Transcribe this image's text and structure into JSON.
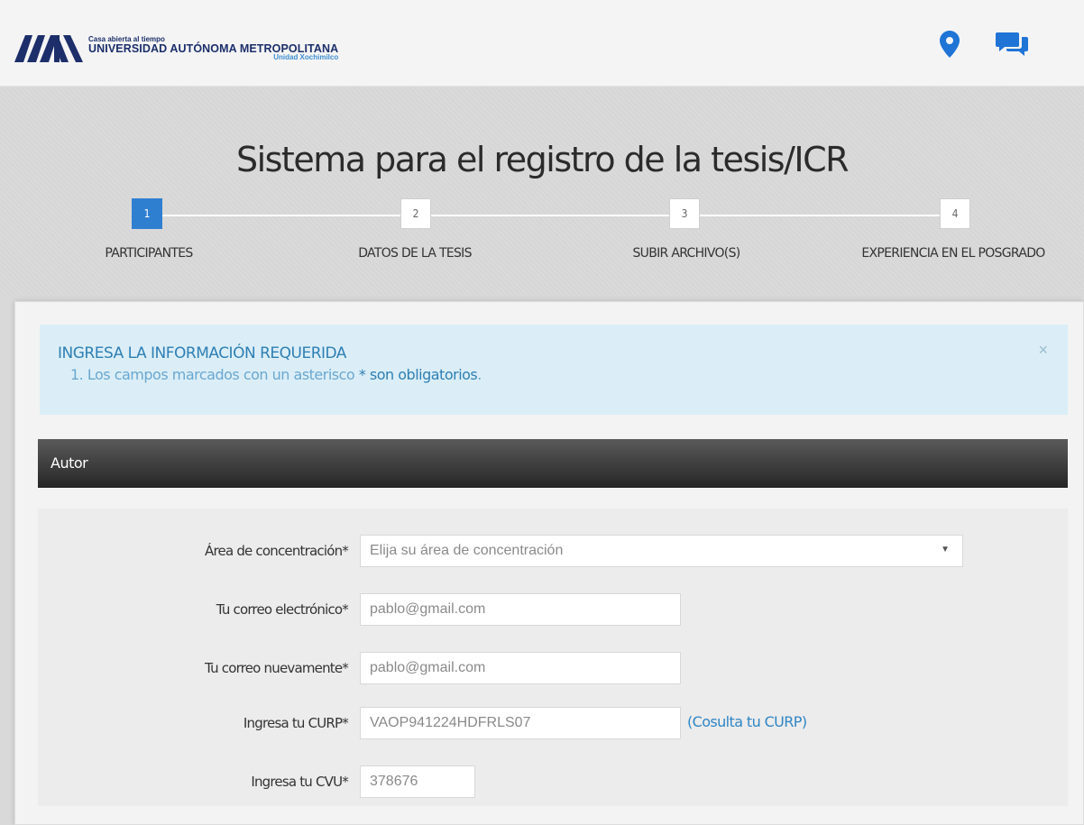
{
  "header": {
    "logo_small": "Casa abierta al tiempo",
    "logo_main": "UNIVERSIDAD AUTÓNOMA METROPOLITANA",
    "logo_sub": "Unidad Xochimilco",
    "icons": [
      "location-pin-icon",
      "chat-icon"
    ],
    "accent": "#1f74d6"
  },
  "page": {
    "title": "Sistema para el registro de la tesis/ICR"
  },
  "wizard": {
    "steps": [
      {
        "number": "1",
        "label": "PARTICIPANTES",
        "active": true
      },
      {
        "number": "2",
        "label": "DATOS DE LA TESIS",
        "active": false
      },
      {
        "number": "3",
        "label": "SUBIR ARCHIVO(S)",
        "active": false
      },
      {
        "number": "4",
        "label": "EXPERIENCIA EN EL POSGRADO",
        "active": false
      }
    ],
    "active_color": "#2f7fd1"
  },
  "alert": {
    "title": "INGRESA LA INFORMACIÓN REQUERIDA",
    "body_prefix": "1. Los campos marcados con un asterisco",
    "body_emphasis": "* son obligatorios",
    "body_suffix": ".",
    "close": "×"
  },
  "section": {
    "title": "Autor"
  },
  "form": {
    "area": {
      "label": "Área de concentración*",
      "placeholder": "Elija su área de concentración"
    },
    "email": {
      "label": "Tu correo electrónico*",
      "value": "pablo@gmail.com"
    },
    "email_confirm": {
      "label": "Tu correo nuevamente*",
      "value": "pablo@gmail.com"
    },
    "curp": {
      "label": "Ingresa tu CURP*",
      "value": "VAOP941224HDFRLS07",
      "link": "(Cosulta tu CURP)"
    },
    "cvu": {
      "label": "Ingresa tu CVU*",
      "value": "378676"
    }
  }
}
